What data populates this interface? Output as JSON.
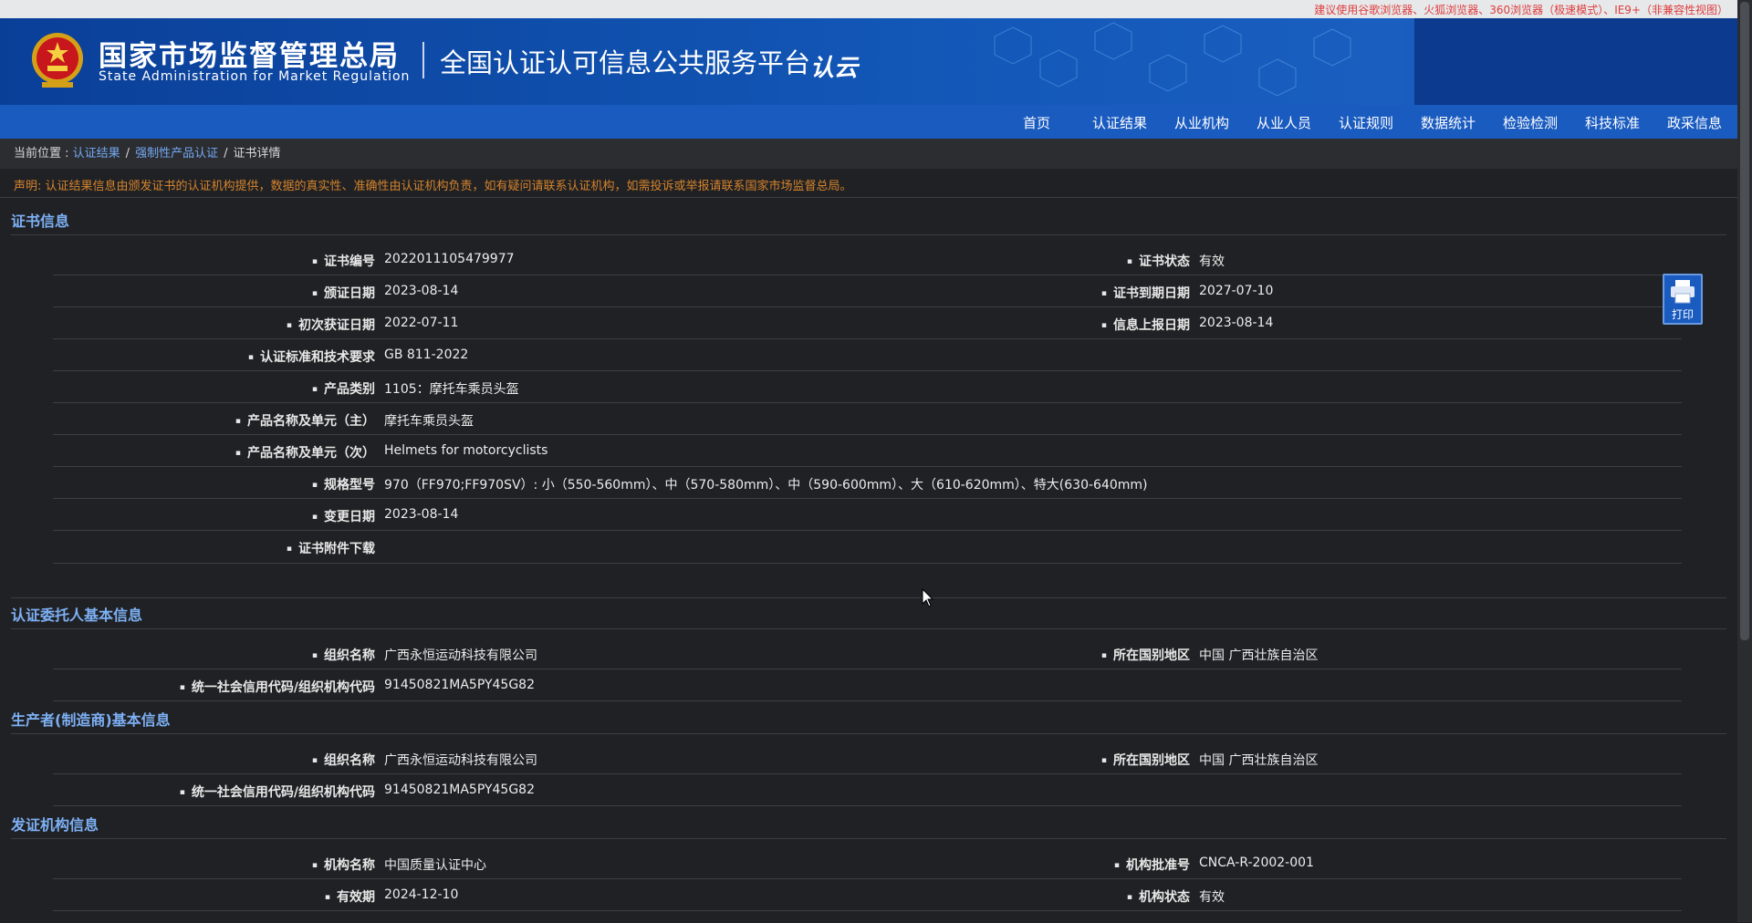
{
  "browser_notice": "建议使用谷歌浏览器、火狐浏览器、360浏览器（极速模式）、IE9+（非兼容性视图）",
  "header": {
    "agency_cn": "国家市场监督管理总局",
    "agency_en": "State Administration for Market Regulation",
    "platform": "全国认证认可信息公共服务平台",
    "logo_text": "认云"
  },
  "nav": [
    "首页",
    "认证结果",
    "从业机构",
    "从业人员",
    "认证规则",
    "数据统计",
    "检验检测",
    "科技标准",
    "政采信息"
  ],
  "breadcrumb": {
    "prefix": "当前位置 : ",
    "items": [
      "认证结果",
      "强制性产品认证",
      "证书详情"
    ],
    "separator": "/"
  },
  "notice": "声明: 认证结果信息由颁发证书的认证机构提供，数据的真实性、准确性由认证机构负责，如有疑问请联系认证机构，如需投诉或举报请联系国家市场监督总局。",
  "print_label": "打印",
  "sections": {
    "certificate": {
      "title": "证书信息",
      "cert_no_label": "证书编号",
      "cert_no": "2022011105479977",
      "status_label": "证书状态",
      "status": "有效",
      "issue_date_label": "颁证日期",
      "issue_date": "2023-08-14",
      "expiry_label": "证书到期日期",
      "expiry": "2027-07-10",
      "first_date_label": "初次获证日期",
      "first_date": "2022-07-11",
      "report_date_label": "信息上报日期",
      "report_date": "2023-08-14",
      "standard_label": "认证标准和技术要求",
      "standard": "GB 811-2022",
      "category_label": "产品类别",
      "category": "1105：摩托车乘员头盔",
      "product_main_label": "产品名称及单元（主）",
      "product_main": "摩托车乘员头盔",
      "product_sub_label": "产品名称及单元（次）",
      "product_sub": "Helmets for motorcyclists",
      "model_label": "规格型号",
      "model": "970（FF970;FF970SV）: 小（550-560mm）、中（570-580mm）、中（590-600mm）、大（610-620mm）、特大(630-640mm)",
      "change_date_label": "变更日期",
      "change_date": "2023-08-14",
      "attachment_label": "证书附件下载"
    },
    "applicant": {
      "title": "认证委托人基本信息",
      "org_label": "组织名称",
      "org": "广西永恒运动科技有限公司",
      "region_label": "所在国别地区",
      "region": "中国 广西壮族自治区",
      "credit_label": "统一社会信用代码/组织机构代码",
      "credit": "91450821MA5PY45G82"
    },
    "manufacturer": {
      "title": "生产者(制造商)基本信息",
      "org_label": "组织名称",
      "org": "广西永恒运动科技有限公司",
      "region_label": "所在国别地区",
      "region": "中国 广西壮族自治区",
      "credit_label": "统一社会信用代码/组织机构代码",
      "credit": "91450821MA5PY45G82"
    },
    "issuer": {
      "title": "发证机构信息",
      "name_label": "机构名称",
      "name": "中国质量认证中心",
      "approval_label": "机构批准号",
      "approval": "CNCA-R-2002-001",
      "validity_label": "有效期",
      "validity": "2024-12-10",
      "status_label": "机构状态",
      "status": "有效"
    }
  }
}
